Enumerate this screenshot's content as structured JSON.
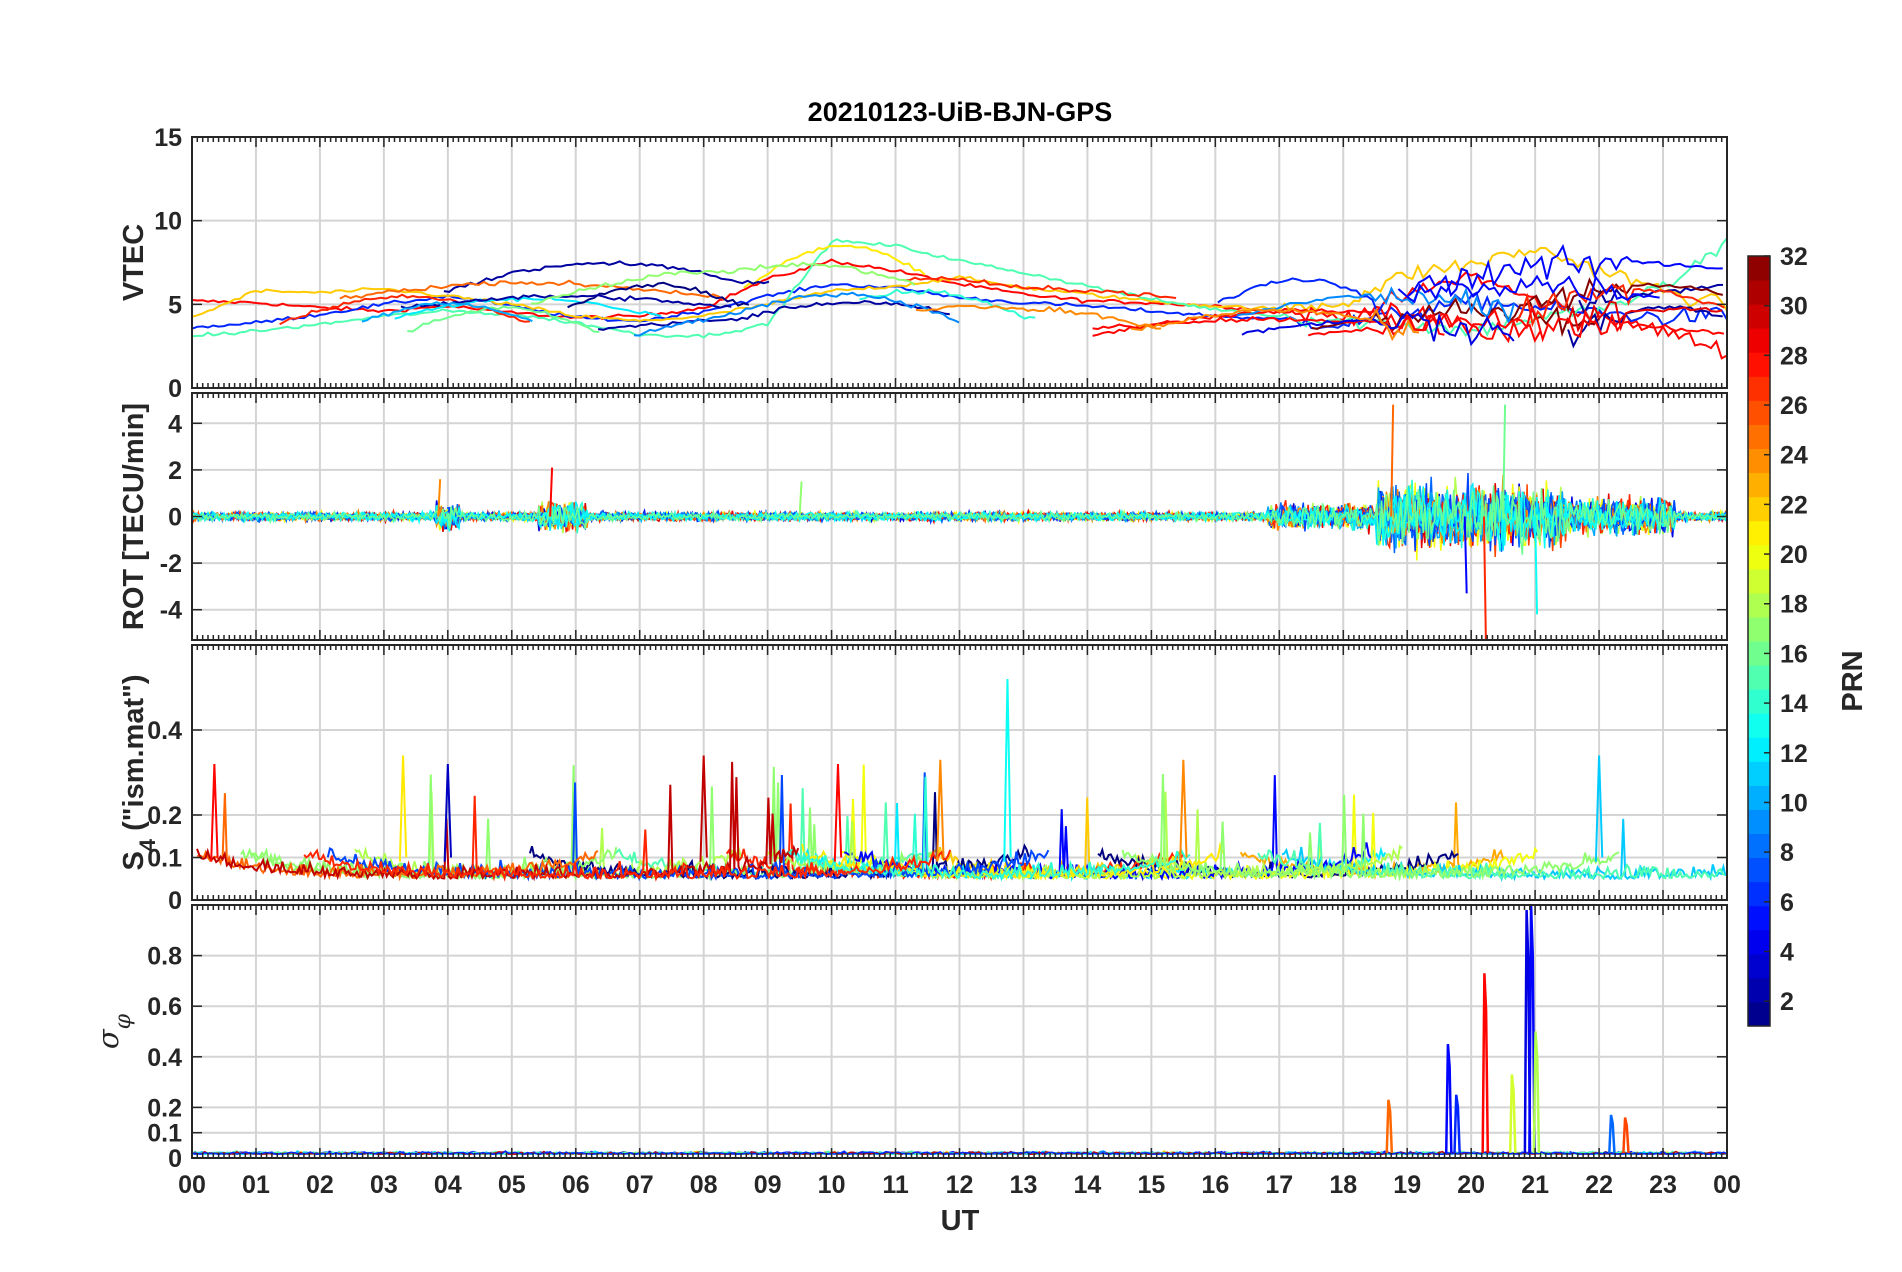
{
  "figure": {
    "title": "20210123-UiB-BJN-GPS",
    "xlabel": "UT"
  },
  "chart_data": [
    {
      "type": "line",
      "panel": "vtec",
      "ylabel": "VTEC",
      "xlim": [
        0,
        24
      ],
      "ylim": [
        0,
        15
      ],
      "yticks": [
        0,
        5,
        10,
        15
      ],
      "grid": true,
      "description_series": [
        {
          "name": "",
          "prn_level": 28,
          "x": [
            0,
            1,
            2,
            3,
            4,
            5,
            6,
            7,
            8,
            9,
            10,
            11,
            12,
            13,
            14,
            15,
            16,
            17,
            18,
            19,
            20,
            21,
            22,
            23,
            24
          ],
          "y": [
            5.2,
            5.1,
            4.8,
            4.6,
            4.9,
            4.5,
            4.2,
            4.3,
            4.8,
            6.5,
            7.6,
            7.0,
            6.2,
            5.6,
            5.2,
            5.1,
            4.9,
            4.6,
            4.2,
            5.5,
            6.8,
            5.2,
            4.3,
            3.4,
            2.2
          ]
        },
        {
          "name": "",
          "prn_level": 6,
          "x": [
            0,
            1,
            2,
            3,
            4,
            5,
            6,
            7,
            8,
            9,
            10,
            11,
            12,
            13,
            14,
            15,
            16,
            17,
            18,
            19,
            20,
            21,
            22,
            23,
            24
          ],
          "y": [
            3.6,
            3.9,
            4.4,
            5.0,
            5.5,
            4.9,
            4.2,
            4.0,
            4.6,
            5.5,
            6.2,
            6.0,
            5.4,
            5.1,
            4.9,
            4.6,
            4.3,
            4.1,
            3.8,
            4.5,
            5.2,
            4.8,
            4.5,
            4.2,
            4.4
          ]
        },
        {
          "name": "",
          "prn_level": 22,
          "x": [
            0,
            1,
            2,
            3,
            4,
            5,
            6,
            7,
            8,
            9,
            10,
            11,
            12,
            13,
            14,
            15,
            16,
            17,
            18,
            19,
            20,
            21,
            22,
            23,
            24
          ],
          "y": [
            4.2,
            5.8,
            5.7,
            5.9,
            5.5,
            5.0,
            4.3,
            4.0,
            4.3,
            5.0,
            5.8,
            6.1,
            6.6,
            6.0,
            5.6,
            5.2,
            4.9,
            4.7,
            5.1,
            6.8,
            7.4,
            8.3,
            7.1,
            5.8,
            4.9
          ]
        },
        {
          "name": "",
          "prn_level": 15,
          "x": [
            0,
            1,
            2,
            3,
            4,
            5,
            6,
            7,
            8,
            9,
            10,
            11,
            12,
            13,
            14,
            15,
            16,
            17,
            18,
            19,
            20,
            21,
            22,
            23,
            24
          ],
          "y": [
            3.1,
            3.4,
            3.8,
            4.3,
            4.6,
            4.4,
            3.9,
            3.2,
            3.1,
            3.8,
            8.8,
            8.5,
            7.6,
            6.9,
            6.1,
            5.3,
            4.7,
            4.3,
            4.0,
            3.8,
            3.4,
            4.2,
            4.6,
            6.0,
            8.6
          ]
        }
      ]
    },
    {
      "type": "line",
      "panel": "rot",
      "ylabel": "ROT [TECU/min]",
      "xlim": [
        0,
        24
      ],
      "ylim": [
        -5.3,
        5.3
      ],
      "yticks": [
        -4,
        -2,
        0,
        2,
        4
      ],
      "grid": true
    },
    {
      "type": "line",
      "panel": "s4",
      "ylabel": "S4 (\"ism.mat\")",
      "ylabel_main": "S",
      "ylabel_sub": "4",
      "ylabel_rest": " (\"ism.mat\")",
      "xlim": [
        0,
        24
      ],
      "ylim": [
        0,
        0.6
      ],
      "yticks": [
        0,
        0.1,
        0.2,
        0.4
      ],
      "grid": true
    },
    {
      "type": "line",
      "panel": "sigma_phi",
      "ylabel": "σφ",
      "ylabel_main": "σ",
      "ylabel_sub": "φ",
      "xlim": [
        0,
        24
      ],
      "ylim": [
        0,
        1
      ],
      "yticks": [
        0,
        0.1,
        0.2,
        0.4,
        0.6,
        0.8
      ],
      "grid": true,
      "spikes": [
        {
          "x": 19.65,
          "y": 0.45,
          "prn_level": 5
        },
        {
          "x": 19.78,
          "y": 0.25,
          "prn_level": 6
        },
        {
          "x": 20.22,
          "y": 0.73,
          "prn_level": 28
        },
        {
          "x": 20.65,
          "y": 0.33,
          "prn_level": 19
        },
        {
          "x": 20.88,
          "y": 0.98,
          "prn_level": 4
        },
        {
          "x": 20.95,
          "y": 1.0,
          "prn_level": 5
        },
        {
          "x": 21.02,
          "y": 0.5,
          "prn_level": 18
        },
        {
          "x": 18.72,
          "y": 0.23,
          "prn_level": 25
        },
        {
          "x": 22.2,
          "y": 0.17,
          "prn_level": 8
        },
        {
          "x": 22.42,
          "y": 0.16,
          "prn_level": 26
        }
      ]
    }
  ],
  "xaxis": {
    "tick_labels": [
      "00",
      "01",
      "02",
      "03",
      "04",
      "05",
      "06",
      "07",
      "08",
      "09",
      "10",
      "11",
      "12",
      "13",
      "14",
      "15",
      "16",
      "17",
      "18",
      "19",
      "20",
      "21",
      "22",
      "23",
      "00"
    ]
  },
  "colorbar": {
    "label": "PRN",
    "colormap": "jet",
    "range": [
      1,
      32
    ],
    "ticks": [
      "2",
      "4",
      "6",
      "8",
      "10",
      "12",
      "14",
      "16",
      "18",
      "20",
      "22",
      "24",
      "26",
      "28",
      "30",
      "32"
    ]
  }
}
